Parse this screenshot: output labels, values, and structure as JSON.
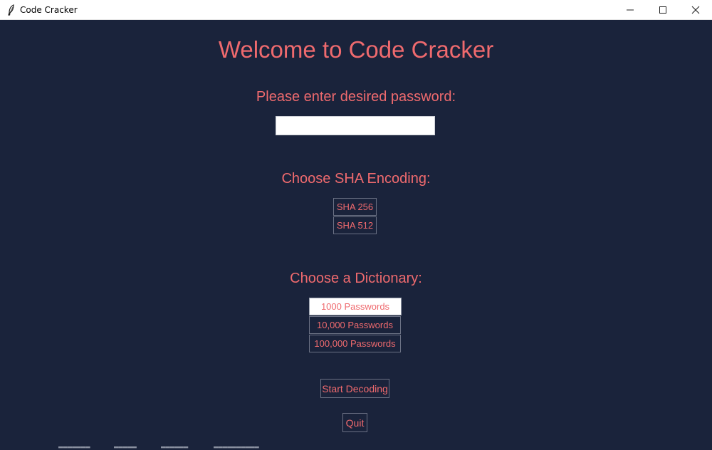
{
  "window": {
    "title": "Code Cracker",
    "app_icon": "feather-icon",
    "controls": [
      "minimize-icon",
      "maximize-icon",
      "close-icon"
    ]
  },
  "main": {
    "title": "Welcome to Code Cracker",
    "password_label": "Please enter desired password:",
    "password_value": "",
    "sha_label": "Choose SHA Encoding:",
    "sha_options": [
      "SHA 256",
      "SHA 512"
    ],
    "dictionary_label": "Choose a Dictionary:",
    "dictionary_options": [
      "1000 Passwords",
      "10,000 Passwords",
      "100,000 Passwords"
    ],
    "dictionary_selected": "1000 Passwords",
    "start_label": "Start Decoding",
    "quit_label": "Quit"
  },
  "colors": {
    "background": "#1a233b",
    "text": "#ef6a6e",
    "input_background": "#ffffff"
  }
}
